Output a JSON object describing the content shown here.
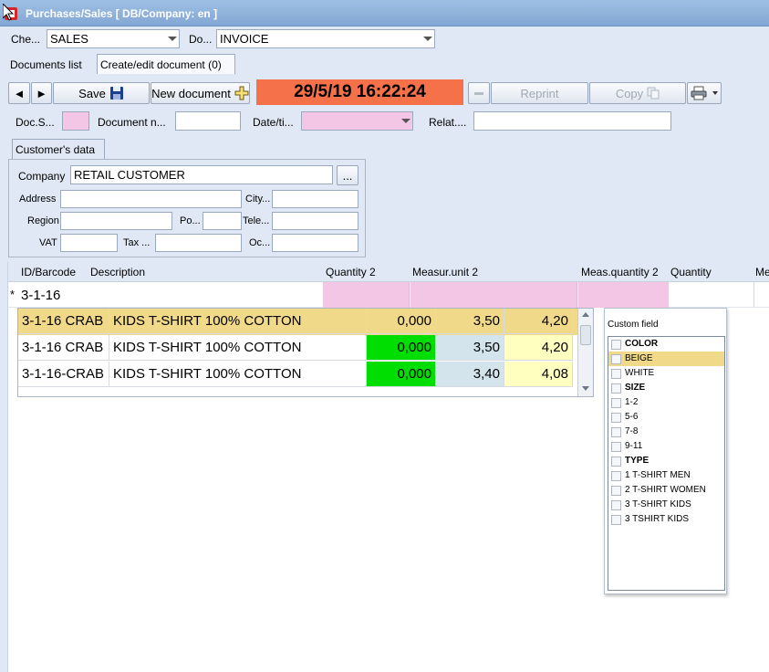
{
  "window": {
    "title": "Purchases/Sales  [ DB/Company: en ]"
  },
  "filters": {
    "che_label": "Che...",
    "che_value": "SALES",
    "do_label": "Do...",
    "do_value": "INVOICE"
  },
  "tabs": [
    {
      "label": "Documents list"
    },
    {
      "label": "Create/edit document (0)"
    }
  ],
  "toolbar": {
    "prev_label": "◄",
    "next_label": "►",
    "save_label": "Save",
    "new_document_label": "New document",
    "datetime": "29/5/19 16:22:24",
    "reprint_label": "Reprint",
    "copy_label": "Copy"
  },
  "docfields": {
    "doc_status_label": "Doc.S...",
    "document_no_label": "Document n...",
    "document_no_value": "",
    "datetime_label": "Date/ti...",
    "related_label": "Relat....",
    "related_value": ""
  },
  "customer": {
    "tab_label": "Customer's data",
    "company_label": "Company",
    "company_value": "RETAIL CUSTOMER",
    "browse_label": "...",
    "address_label": "Address",
    "city_label": "City...",
    "region_label": "Region",
    "po_label": "Po...",
    "tele_label": "Tele...",
    "vat_label": "VAT",
    "tax_label": "Tax ...",
    "oc_label": "Oc..."
  },
  "grid": {
    "columns": [
      "ID/Barcode",
      "Description",
      "Quantity 2",
      "Measur.unit 2",
      "Meas.quantity 2",
      "Quantity",
      "Me"
    ],
    "new_row_marker": "*",
    "new_row_id": "3-1-16"
  },
  "subgrid": {
    "rows": [
      {
        "id": "3-1-16 CRAB",
        "description": "KIDS T-SHIRT 100% COTTON",
        "qty": "0,000",
        "price": "3,50",
        "total": "4,20"
      },
      {
        "id": "3-1-16 CRAB",
        "description": "KIDS T-SHIRT 100% COTTON",
        "qty": "0,000",
        "price": "3,50",
        "total": "4,20"
      },
      {
        "id": "3-1-16-CRAB",
        "description": "KIDS T-SHIRT 100% COTTON",
        "qty": "0,000",
        "price": "3,40",
        "total": "4,08"
      }
    ]
  },
  "custom_field": {
    "title": "Custom field",
    "items": [
      {
        "label": "COLOR",
        "header": true
      },
      {
        "label": "BEIGE",
        "selected": true
      },
      {
        "label": "WHITE"
      },
      {
        "label": "SIZE",
        "header": true
      },
      {
        "label": "1-2"
      },
      {
        "label": "5-6"
      },
      {
        "label": "7-8"
      },
      {
        "label": "9-11"
      },
      {
        "label": "TYPE",
        "header": true
      },
      {
        "label": "1 T-SHIRT MEN"
      },
      {
        "label": "2 T-SHIRT WOMEN"
      },
      {
        "label": "3 T-SHIRT KIDS"
      },
      {
        "label": "3 TSHIRT KIDS"
      }
    ]
  },
  "colors": {
    "datetime_bg": "#f5714a",
    "highlight_row": "#f1d98a",
    "green_cell": "#00dd00",
    "pink_field": "#f4c6e6",
    "yellow_cell": "#ffffc0"
  },
  "icons": {
    "save": "floppy-disk-icon",
    "new_document": "plus-icon",
    "copy": "copy-icon",
    "print": "printer-icon",
    "app": "app-icon"
  }
}
